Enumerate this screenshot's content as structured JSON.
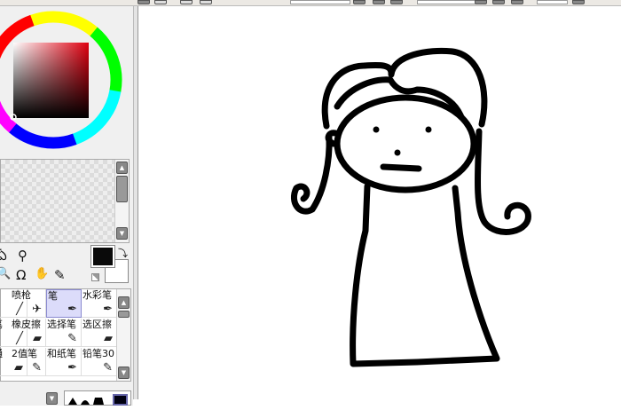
{
  "app": "PaintTool SAI",
  "colors": {
    "primary": "#0a0a0a",
    "secondary": "#ffffff",
    "selected_tool_bg": "#dcdcfa"
  },
  "tools": [
    {
      "name": "lasso",
      "icon": "lasso-icon",
      "glyph": "ఏ"
    },
    {
      "name": "magic-wand",
      "icon": "magic-wand-icon",
      "glyph": "⚲"
    },
    {
      "name": "zoom",
      "icon": "magnifier-icon",
      "glyph": "🔍"
    },
    {
      "name": "rotate",
      "icon": "rotate-icon",
      "glyph": "Ω"
    },
    {
      "name": "hand",
      "icon": "hand-icon",
      "glyph": "✋"
    },
    {
      "name": "eyedropper",
      "icon": "eyedropper-icon",
      "glyph": "✎"
    }
  ],
  "brushes": [
    {
      "label": "",
      "icon": "╱"
    },
    {
      "label": "喷枪",
      "icon": "✈"
    },
    {
      "label": "笔",
      "icon": "✒"
    },
    {
      "label": "水彩笔",
      "icon": "✒"
    },
    {
      "label": "笔",
      "icon": "╱"
    },
    {
      "label": "橡皮擦",
      "icon": "▰"
    },
    {
      "label": "选择笔",
      "icon": "✎"
    },
    {
      "label": "选区擦",
      "icon": "▰"
    },
    {
      "label": "通",
      "icon": "▰"
    },
    {
      "label": "2值笔",
      "icon": "✎"
    },
    {
      "label": "和纸笔",
      "icon": "✒"
    },
    {
      "label": "铅笔30",
      "icon": "✎"
    }
  ],
  "scroll": {
    "up": "▲",
    "down": "▼"
  }
}
